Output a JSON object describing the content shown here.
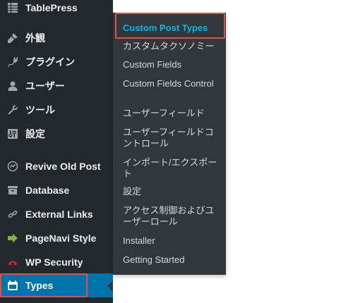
{
  "sidebar": {
    "items": [
      {
        "label": "TablePress",
        "icon": "table-icon"
      },
      {
        "label": "外観",
        "icon": "paintbrush-icon"
      },
      {
        "label": "プラグイン",
        "icon": "plugin-icon"
      },
      {
        "label": "ユーザー",
        "icon": "user-icon"
      },
      {
        "label": "ツール",
        "icon": "wrench-icon"
      },
      {
        "label": "設定",
        "icon": "settings-icon"
      },
      {
        "label": "Revive Old Post",
        "icon": "revive-icon"
      },
      {
        "label": "Database",
        "icon": "database-icon"
      },
      {
        "label": "External Links",
        "icon": "link-icon"
      },
      {
        "label": "PageNavi Style",
        "icon": "pagenavi-icon"
      },
      {
        "label": "WP Security",
        "icon": "security-icon"
      },
      {
        "label": "Types",
        "icon": "types-icon"
      }
    ]
  },
  "submenu": {
    "items": [
      {
        "label": "Custom Post Types"
      },
      {
        "label": "カスタムタクソノミー"
      },
      {
        "label": "Custom Fields"
      },
      {
        "label": "Custom Fields Control"
      },
      {
        "label": "ユーザーフィールド"
      },
      {
        "label": "ユーザーフィールドコントロール"
      },
      {
        "label": "インポート/エクスポート"
      },
      {
        "label": "設定"
      },
      {
        "label": "アクセス制御およびユーザーロール"
      },
      {
        "label": "Installer"
      },
      {
        "label": "Getting Started"
      }
    ]
  },
  "colors": {
    "sidebar_bg": "#23282d",
    "submenu_bg": "#32373c",
    "active_bg": "#0073aa",
    "current_link": "#00b9eb",
    "annotation_outline": "#d9534f"
  }
}
